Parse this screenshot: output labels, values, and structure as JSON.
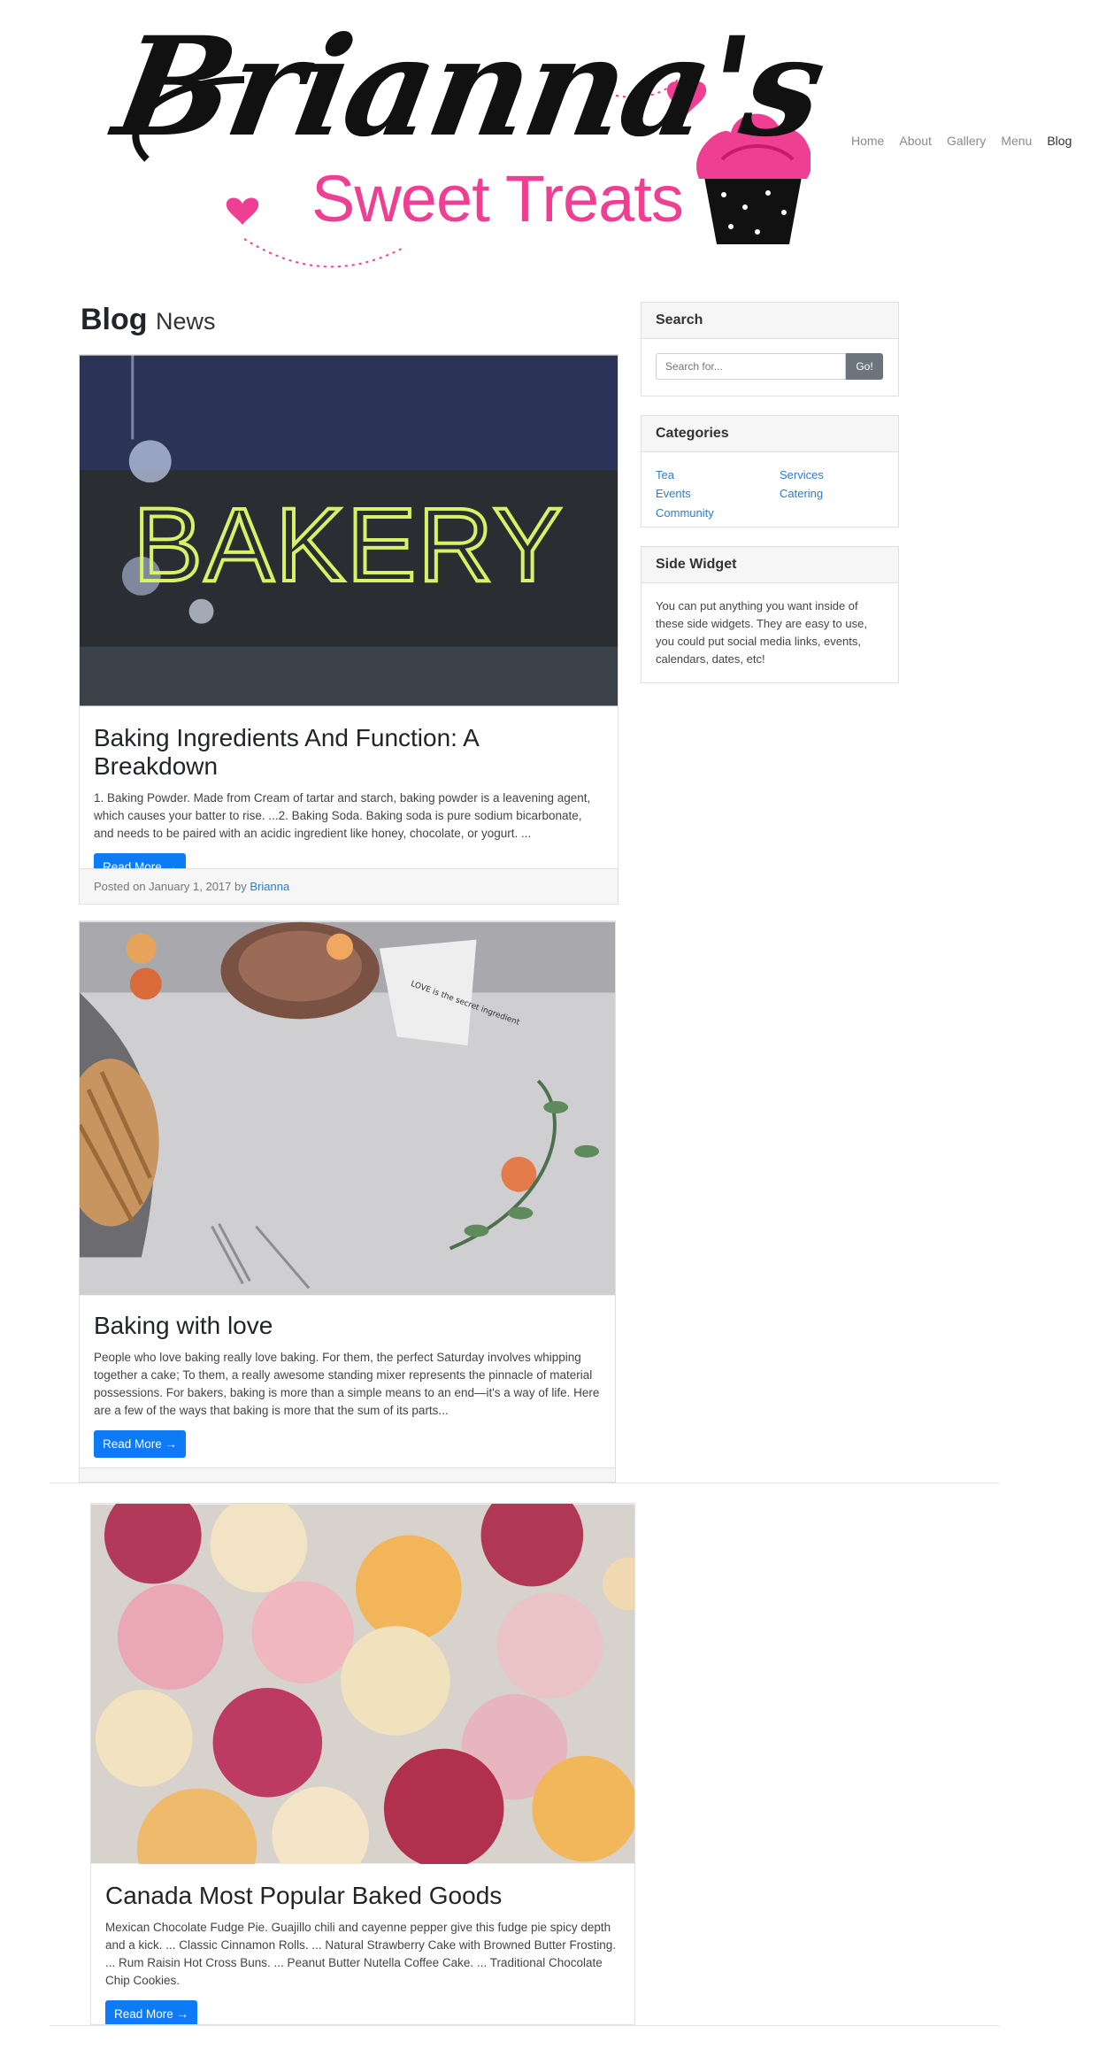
{
  "brand": {
    "script_text": "Brianna's",
    "sub_text": "Sweet Treats",
    "pink": "#ee3f93"
  },
  "nav": {
    "items": [
      {
        "label": "Home",
        "active": false
      },
      {
        "label": "About",
        "active": false
      },
      {
        "label": "Gallery",
        "active": false
      },
      {
        "label": "Menu",
        "active": false
      },
      {
        "label": "Blog",
        "active": true
      }
    ]
  },
  "heading": {
    "main": "Blog",
    "small": "News"
  },
  "posts": [
    {
      "image_label": "BAKERY",
      "title": "Baking Ingredients And Function: A Breakdown",
      "excerpt": "1. Baking Powder. Made from Cream of tartar and starch, baking powder is a leavening agent, which causes your batter to rise. ...2. Baking Soda. Baking soda is pure sodium bicarbonate, and needs to be paired with an acidic ingredient like honey, chocolate, or yogurt. ...",
      "button": "Read More →",
      "footer_prefix": "Posted on January 1, 2017 by",
      "author": "Brianna"
    },
    {
      "image_note": "LOVE is the secret ingredient",
      "title": "Baking with love",
      "excerpt": "People who love baking really love baking. For them, the perfect Saturday involves whipping together a cake; To them, a really awesome standing mixer represents the pinnacle of material possessions. For bakers, baking is more than a simple means to an end—it's a way of life. Here are a few of the ways that baking is more that the sum of its parts...",
      "button": "Read More →"
    },
    {
      "title": "Canada Most Popular Baked Goods",
      "excerpt": "Mexican Chocolate Fudge Pie. Guajillo chili and cayenne pepper give this fudge pie spicy depth and a kick. ... Classic Cinnamon Rolls. ... Natural Strawberry Cake with Browned Butter Frosting. ... Rum Raisin Hot Cross Buns. ... Peanut Butter Nutella Coffee Cake. ... Traditional Chocolate Chip Cookies.",
      "button": "Read More →"
    }
  ],
  "sidebar": {
    "search": {
      "title": "Search",
      "placeholder": "Search for...",
      "button": "Go!"
    },
    "categories": {
      "title": "Categories",
      "items": [
        "Tea",
        "Services",
        "Events",
        "Catering",
        "Community"
      ]
    },
    "widget": {
      "title": "Side Widget",
      "text": "You can put anything you want inside of these side widgets. They are easy to use, you could put social media links, events, calendars, dates, etc!"
    }
  },
  "colors": {
    "link": "#2b7bd1",
    "button": "#0d7bf5",
    "go_button": "#6c757d"
  }
}
